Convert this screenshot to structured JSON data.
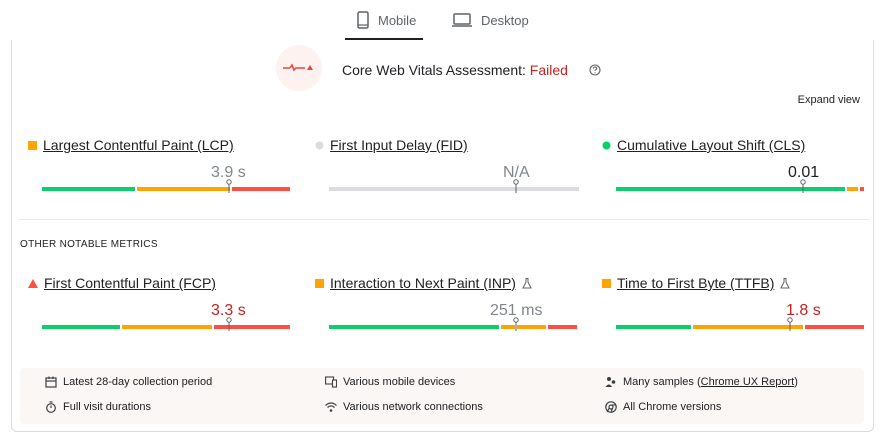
{
  "tabs": {
    "mobile": "Mobile",
    "desktop": "Desktop",
    "active": "mobile"
  },
  "assessment": {
    "prefix": "Core Web Vitals Assessment: ",
    "status": "Failed",
    "status_color": "#c5221f"
  },
  "expand_view": "Expand view",
  "core_metrics": [
    {
      "name": "Largest Contentful Paint (LCP)",
      "value": "3.9 s",
      "marker": "orange-square",
      "value_color": "#80868b",
      "marker_fraction": 0.76,
      "segments_fraction": [
        0.38,
        0.38,
        0.24
      ],
      "flask": false
    },
    {
      "name": "First Input Delay (FID)",
      "value": "N/A",
      "marker": "gray-circle",
      "value_color": "#80868b",
      "marker_fraction": 0.75,
      "segments_fraction": [
        1.0
      ],
      "flask": false
    },
    {
      "name": "Cumulative Layout Shift (CLS)",
      "value": "0.01",
      "marker": "green-circle",
      "value_color": "#202124",
      "marker_fraction": 0.75,
      "segments_fraction": [
        0.93,
        0.04,
        0.03
      ],
      "flask": false
    }
  ],
  "other_label": "OTHER NOTABLE METRICS",
  "other_metrics": [
    {
      "name": "First Contentful Paint (FCP)",
      "value": "3.3 s",
      "marker": "red-triangle",
      "value_color": "#c5221f",
      "marker_fraction": 0.75,
      "segments_fraction": [
        0.32,
        0.36,
        0.32
      ],
      "flask": false
    },
    {
      "name": "Interaction to Next Paint (INP)",
      "value": "251 ms",
      "marker": "orange-square",
      "value_color": "#80868b",
      "marker_fraction": 0.75,
      "segments_fraction": [
        0.69,
        0.07,
        0.12,
        0.12
      ],
      "flask": true
    },
    {
      "name": "Time to First Byte (TTFB)",
      "value": "1.8 s",
      "marker": "orange-square",
      "value_color": "#c5221f",
      "marker_fraction": 0.75,
      "segments_fraction": [
        0.31,
        0.44,
        0.25
      ],
      "flask": true
    }
  ],
  "info": {
    "period": "Latest 28-day collection period",
    "devices": "Various mobile devices",
    "samples_prefix": "Many samples (",
    "samples_link": "Chrome UX Report",
    "samples_suffix": ")",
    "durations": "Full visit durations",
    "network": "Various network connections",
    "versions": "All Chrome versions"
  },
  "colors": {
    "good": "#0cce6b",
    "needs_improvement": "#ffa400",
    "poor": "#ff4e42",
    "neutral": "#dadce0"
  }
}
